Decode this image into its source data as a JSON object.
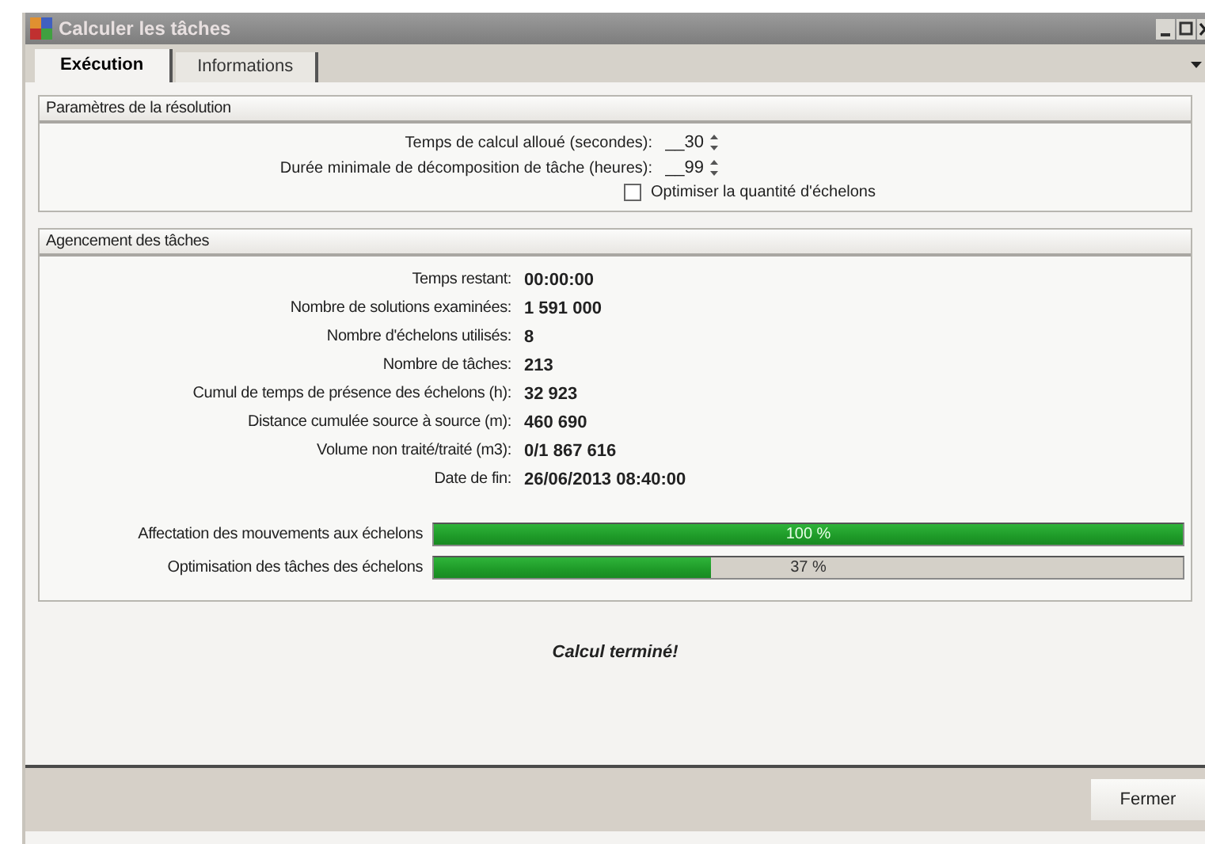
{
  "window": {
    "title": "Calculer les tâches"
  },
  "tabs": [
    {
      "label": "Exécution",
      "selected": true
    },
    {
      "label": "Informations",
      "selected": false
    }
  ],
  "resolution": {
    "title": "Paramètres de la résolution",
    "fields": [
      {
        "label": "Temps de calcul alloué (secondes):",
        "value": "__30"
      },
      {
        "label": "Durée minimale de décomposition de tâche (heures):",
        "value": "__99"
      }
    ],
    "checkbox": {
      "label": "Optimiser la quantité d'échelons",
      "checked": false
    }
  },
  "layout": {
    "title": "Agencement des tâches",
    "stats": [
      {
        "label": "Temps restant:",
        "value": "00:00:00"
      },
      {
        "label": "Nombre de solutions examinées:",
        "value": "1 591 000"
      },
      {
        "label": "Nombre d'échelons utilisés:",
        "value": "8"
      },
      {
        "label": "Nombre de tâches:",
        "value": "213"
      },
      {
        "label": "Cumul de temps de présence des échelons (h):",
        "value": "32 923"
      },
      {
        "label": "Distance cumulée source à source (m):",
        "value": "460 690"
      },
      {
        "label": "Volume non traité/traité (m3):",
        "value": "0/1 867 616"
      },
      {
        "label": "Date de fin:",
        "value": "26/06/2013 08:40:00"
      }
    ],
    "progress": [
      {
        "label": "Affectation des mouvements aux échelons",
        "level": 1,
        "reading": "100 %"
      },
      {
        "label": "Optimisation des tâches des échelons",
        "level": 0.37,
        "reading": "37 %"
      }
    ]
  },
  "status": "Calcul terminé!",
  "buttons": [
    "Fermer"
  ]
}
